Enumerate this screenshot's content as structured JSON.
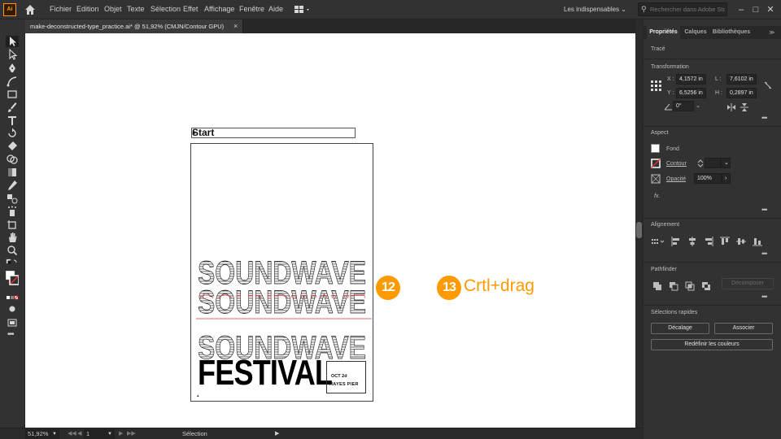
{
  "app": {
    "logo": "Ai"
  },
  "menu": [
    "Fichier",
    "Edition",
    "Objet",
    "Texte",
    "Sélection",
    "Effet",
    "Affichage",
    "Fenêtre",
    "Aide"
  ],
  "workspace": {
    "label": "Les indispensables"
  },
  "search": {
    "placeholder": "Rechercher dans Adobe Stock"
  },
  "document": {
    "tab_title": "make-deconstructed-type_practice.ai* @ 51,92% (CMJN/Contour GPU)"
  },
  "canvas": {
    "start_label": "Start",
    "poster": {
      "sound_lines": [
        "SOUNDWAVE",
        "SOUNDWAVE",
        "SOUNDWAVE",
        "SOUNDWAVE"
      ],
      "festival": "FESTIVAL",
      "date": "OCT 2d",
      "venue": "HAYES PIER"
    },
    "step12": "12",
    "step13": "13",
    "step13_text": "Crtl+drag"
  },
  "status": {
    "zoom": "51,92%",
    "page": "1",
    "tool": "Sélection"
  },
  "panel": {
    "tabs": [
      "Propriétés",
      "Calques",
      "Bibliothèques"
    ],
    "selection_type": "Tracé",
    "transform": {
      "title": "Transformation",
      "x_label": "X :",
      "x_value": "4,1572 in",
      "y_label": "Y :",
      "y_value": "6,5256 in",
      "w_label": "L :",
      "w_value": "7,6102 in",
      "h_label": "H :",
      "h_value": "0,2897 in",
      "angle_value": "0°"
    },
    "aspect": {
      "title": "Aspect",
      "fill": "Fond",
      "stroke": "Contour",
      "opacity_label": "Opacité",
      "opacity_value": "100%",
      "fx": "fx."
    },
    "align": {
      "title": "Alignement"
    },
    "pathfinder": {
      "title": "Pathfinder",
      "expand": "Décomposer"
    },
    "quick": {
      "title": "Sélections rapides",
      "offset": "Décalage",
      "join": "Associer",
      "recolor": "Redéfinir les couleurs"
    }
  },
  "colors": {
    "accent": "#ff9a00",
    "ui_dark": "#323232",
    "canvas": "#ffffff",
    "guide_red": "#e03030"
  }
}
